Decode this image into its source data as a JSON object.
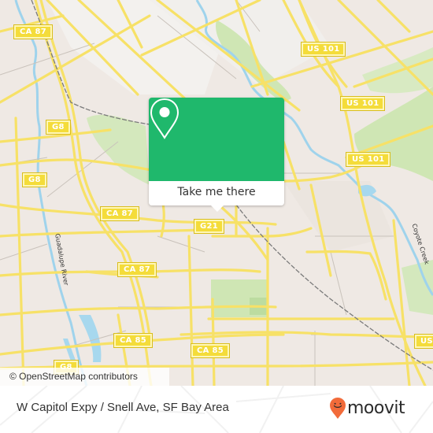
{
  "map": {
    "colors": {
      "land": "#efe9e4",
      "park": "#cfe6b4",
      "water": "#a7d8ee",
      "road_major": "#f7e167",
      "road_minor": "#ffffff",
      "rail": "#7a7a7a"
    },
    "road_shields": [
      {
        "label": "CA 87"
      },
      {
        "label": "US 101"
      },
      {
        "label": "US 101"
      },
      {
        "label": "US 101"
      },
      {
        "label": "G8"
      },
      {
        "label": "G8"
      },
      {
        "label": "CA 87"
      },
      {
        "label": "G21"
      },
      {
        "label": "CA 87"
      },
      {
        "label": "CA 85"
      },
      {
        "label": "CA 85"
      },
      {
        "label": "G8"
      },
      {
        "label": "US"
      }
    ],
    "water_labels": [
      {
        "label": "Guadalupe River"
      },
      {
        "label": "Coyote Creek"
      }
    ],
    "attribution": "© OpenStreetMap contributors"
  },
  "popup": {
    "icon": "map-pin-icon",
    "button_label": "Take me there",
    "accent_color": "#1fb86c"
  },
  "footer": {
    "title": "W Capitol Expy / Snell Ave, SF Bay Area",
    "logo_text": "moovit",
    "logo_icon": "moovit-pin-smile-icon",
    "logo_color": "#f26b3a"
  }
}
